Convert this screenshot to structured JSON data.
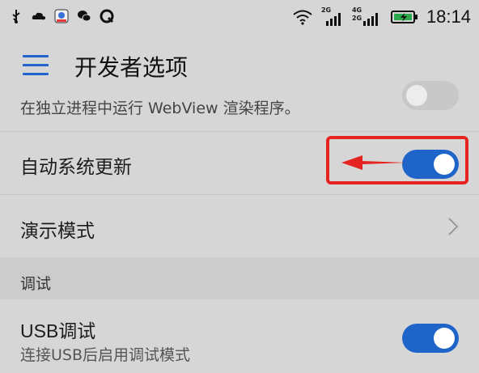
{
  "status_bar": {
    "time": "18:14",
    "left_icons": [
      "usb-icon",
      "cloud-icon",
      "video-app-icon",
      "wechat-icon",
      "q-app-icon"
    ],
    "right_icons": [
      "wifi-icon",
      "signal-2g-icon",
      "signal-4g-icon",
      "battery-charging-icon"
    ],
    "signal_labels": {
      "a": "2G",
      "b": "4G",
      "c": "2G"
    }
  },
  "toolbar": {
    "title": "开发者选项"
  },
  "items": {
    "webview": {
      "subtitle": "在独立进程中运行 WebView 渲染程序。",
      "toggle_on": false
    },
    "auto_update": {
      "label": "自动系统更新",
      "toggle_on": true
    },
    "demo_mode": {
      "label": "演示模式"
    },
    "section_debug": {
      "label": "调试"
    },
    "usb_debug": {
      "label": "USB调试",
      "subtitle": "连接USB后启用调试模式",
      "toggle_on": true
    }
  },
  "annotation": {
    "color": "#e52421"
  },
  "colors": {
    "accent": "#1f64c8",
    "background": "#d6d6d6",
    "section": "#cccccc"
  }
}
